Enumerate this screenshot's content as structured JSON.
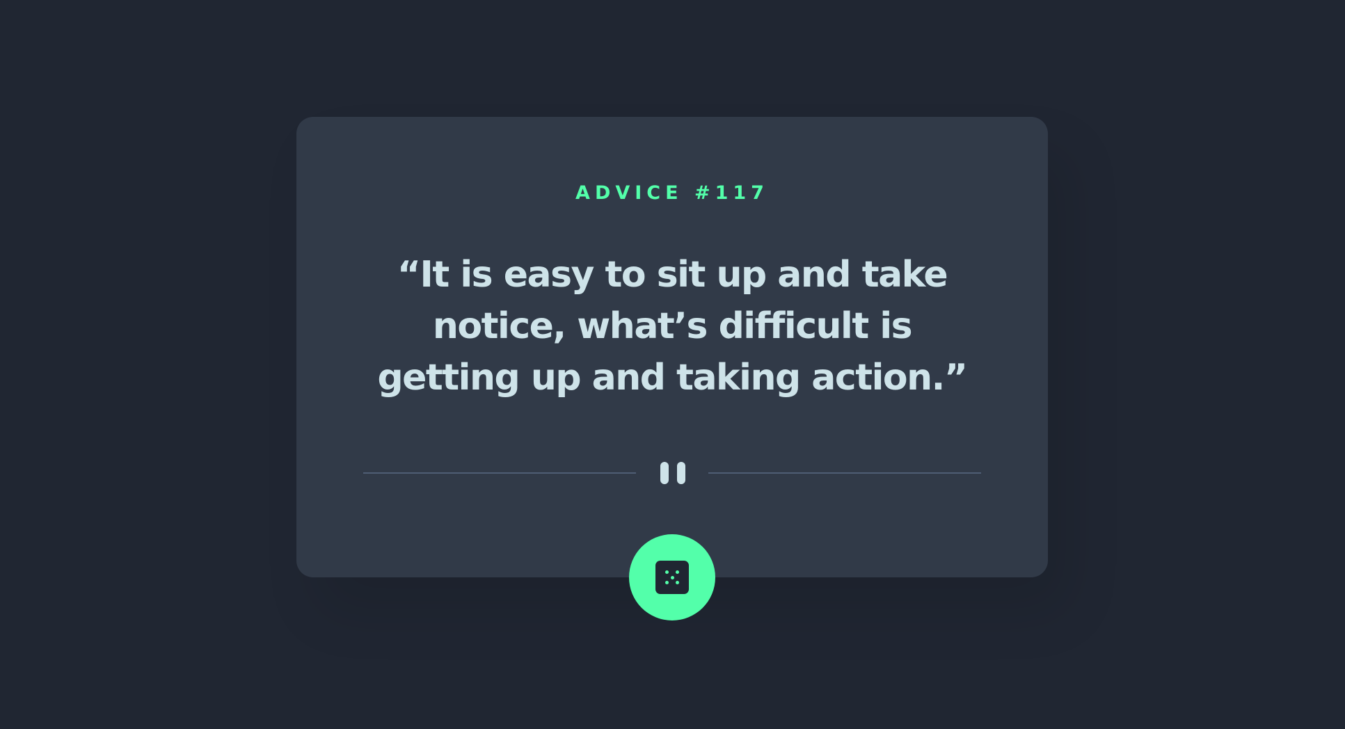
{
  "advice": {
    "id_label": "ADVICE #117",
    "quote": "“It is easy to sit up and take notice, what’s difficult is getting up and taking action.”"
  },
  "divider": {
    "icon": "pause-icon"
  },
  "action": {
    "icon": "dice-icon"
  },
  "colors": {
    "background": "#202632",
    "card": "#313a48",
    "accent": "#53ffaa",
    "text": "#cee3e9",
    "divider_line": "#4f5d74"
  }
}
